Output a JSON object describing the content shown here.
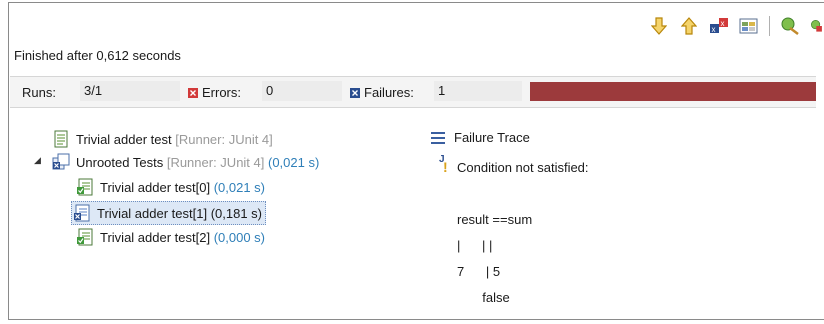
{
  "toolbar": {
    "buttons": [
      {
        "icon": "next-failure-arrow-down-icon"
      },
      {
        "icon": "previous-failure-arrow-up-icon"
      },
      {
        "icon": "show-failures-only-icon"
      },
      {
        "icon": "scroll-lock-icon"
      },
      {
        "icon": "rerun-test-icon"
      },
      {
        "icon": "rerun-failures-first-icon"
      }
    ]
  },
  "status": {
    "finished": "Finished after 0,612 seconds"
  },
  "counters": {
    "runs_label": "Runs:",
    "runs_value": "3/1",
    "errors_label": "Errors:",
    "errors_value": "0",
    "failures_label": "Failures:",
    "failures_value": "1",
    "progress_color": "#9c3a3c",
    "progress_fraction": 1.0
  },
  "tree": {
    "root": {
      "name": "Trivial adder test",
      "runner": "[Runner: JUnit 4]"
    },
    "unrooted": {
      "name": "Unrooted Tests",
      "runner": "[Runner: JUnit 4]",
      "time": "(0,021 s)"
    },
    "tests": [
      {
        "name": "Trivial adder test[0]",
        "time": "(0,021 s)",
        "selected": false
      },
      {
        "name": "Trivial adder test[1]",
        "time": "(0,181 s)",
        "selected": true
      },
      {
        "name": "Trivial adder test[2]",
        "time": "(0,000 s)",
        "selected": false
      }
    ]
  },
  "trace": {
    "title": "Failure Trace",
    "lines": [
      "Condition not satisfied:",
      "",
      "result ==sum",
      "|      | |",
      "7      | 5",
      "       false"
    ]
  }
}
